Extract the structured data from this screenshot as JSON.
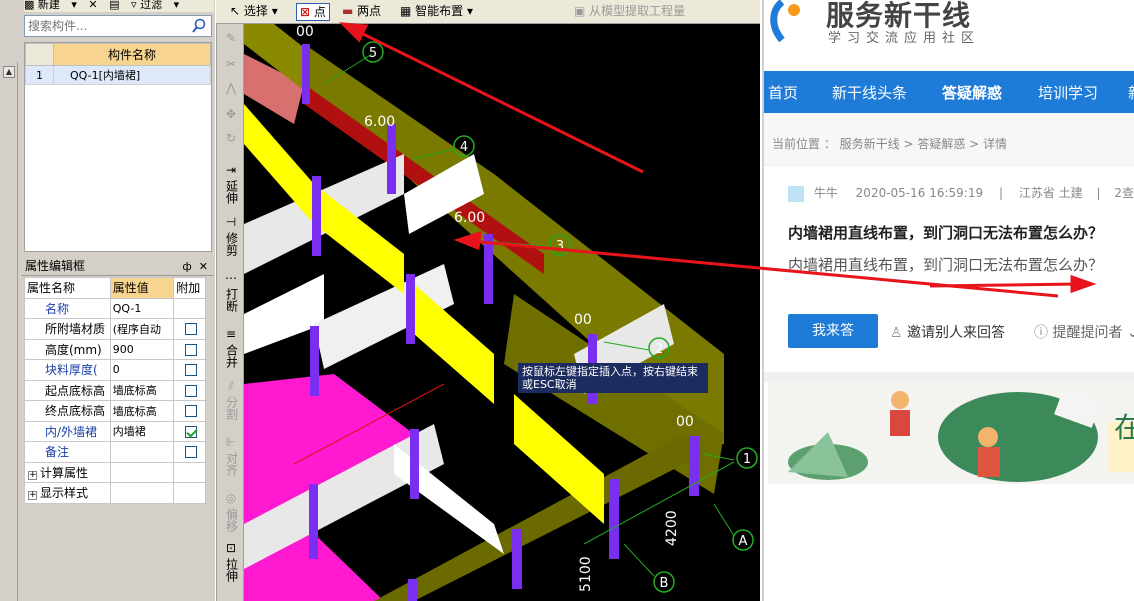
{
  "left_panel": {
    "toolbar": {
      "new_label": "新建",
      "filter_label": "过滤"
    },
    "search": {
      "placeholder": "搜索构件..."
    },
    "component_table": {
      "header": "构件名称",
      "rows": [
        {
          "num": "1",
          "name": "QQ-1[内墙裙]"
        }
      ]
    },
    "property_frame": {
      "title": "属性编辑框",
      "pin": "ф",
      "close": "✕",
      "headers": [
        "属性名称",
        "属性值",
        "附加"
      ],
      "rows": [
        {
          "name": "名称",
          "value": "QQ-1",
          "checkbox": "none",
          "blue": true
        },
        {
          "name": "所附墙材质",
          "value": "(程序自动",
          "checkbox": "off",
          "blue": false
        },
        {
          "name": "高度(mm)",
          "value": "900",
          "checkbox": "off",
          "blue": false
        },
        {
          "name": "块料厚度(",
          "value": "0",
          "checkbox": "off",
          "blue": true
        },
        {
          "name": "起点底标高",
          "value": "墙底标高",
          "checkbox": "off",
          "blue": false
        },
        {
          "name": "终点底标高",
          "value": "墙底标高",
          "checkbox": "off",
          "blue": false
        },
        {
          "name": "内/外墙裙",
          "value": "内墙裙",
          "checkbox": "on",
          "blue": true
        },
        {
          "name": "备注",
          "value": "",
          "checkbox": "off",
          "blue": true
        }
      ],
      "groups": [
        "计算属性",
        "显示样式"
      ]
    }
  },
  "toolbar": {
    "select": "选择",
    "point": "点",
    "two_points": "两点",
    "smart_layout": "智能布置",
    "extract": "从模型提取工程量"
  },
  "vertical_tools": [
    "延伸",
    "修剪",
    "打断",
    "合并",
    "分割",
    "对齐",
    "偏移",
    "拉伸"
  ],
  "viewport": {
    "tooltip": "按鼠标左键指定插入点，按右键结束或ESC取消",
    "axis_labels": [
      "5",
      "4",
      "3",
      "2",
      "1",
      "A",
      "B"
    ],
    "dim_labels": [
      "00",
      "6.00",
      "6.00",
      "00",
      "00"
    ],
    "dimensions": [
      "4200",
      "5100"
    ]
  },
  "browser": {
    "logo_title": "服务新干线",
    "logo_sub": "学习交流应用社区",
    "nav": [
      "首页",
      "新干线头条",
      "答疑解惑",
      "培训学习",
      "新"
    ],
    "breadcrumb": "当前位置 ： 服务新干线 > 答疑解惑 > 详情",
    "meta": {
      "user": "牛牛",
      "datetime": "2020-05-16 16:59:19",
      "location": "江苏省 土建",
      "extra": "2查"
    },
    "question_title": "内墙裙用直线布置，到门洞口无法布置怎么办？",
    "question_body": "内墙裙用直线布置，到门洞口无法布置怎么办？",
    "answer_button": "我来答",
    "invite": "邀请别人来回答",
    "remind": "提醒提问者",
    "banner_text": "在"
  },
  "colors": {
    "nav_blue": "#1e7bd8",
    "header_orange": "#f7d590",
    "annotation_red": "#e8141b",
    "wall_olive": "#8a8a00",
    "wall_yellow": "#ffff00",
    "wall_magenta": "#ff19d0",
    "column_purple": "#7a2ef0"
  }
}
